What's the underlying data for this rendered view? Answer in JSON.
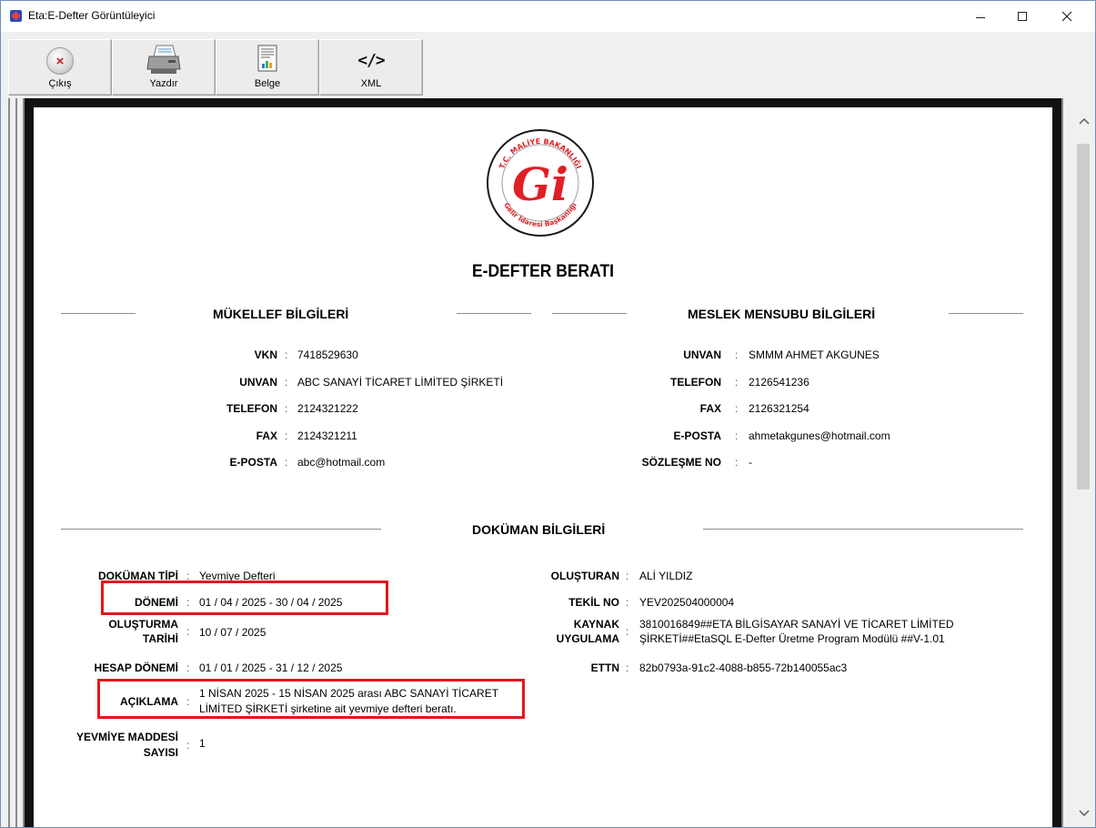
{
  "window": {
    "title": "Eta:E-Defter Görüntüleyici"
  },
  "toolbar": {
    "exit_label": "Çıkış",
    "print_label": "Yazdır",
    "document_label": "Belge",
    "xml_label": "XML",
    "xml_glyph": "</>"
  },
  "document": {
    "title": "E-DEFTER BERATI",
    "taxpayer": {
      "heading": "MÜKELLEF BİLGİLERİ",
      "fields": [
        {
          "label": "VKN",
          "value": "7418529630"
        },
        {
          "label": "UNVAN",
          "value": "ABC SANAYİ TİCARET LİMİTED ŞİRKETİ"
        },
        {
          "label": "TELEFON",
          "value": "2124321222"
        },
        {
          "label": "FAX",
          "value": "2124321211"
        },
        {
          "label": "E-POSTA",
          "value": "abc@hotmail.com"
        }
      ]
    },
    "accountant": {
      "heading": "MESLEK MENSUBU BİLGİLERİ",
      "fields": [
        {
          "label": "UNVAN",
          "value": "SMMM AHMET AKGUNES"
        },
        {
          "label": "TELEFON",
          "value": "2126541236"
        },
        {
          "label": "FAX",
          "value": "2126321254"
        },
        {
          "label": "E-POSTA",
          "value": "ahmetakgunes@hotmail.com"
        },
        {
          "label": "SÖZLEŞME NO",
          "value": "-"
        }
      ]
    },
    "doc_info": {
      "heading": "DOKÜMAN BİLGİLERİ",
      "left": [
        {
          "label": "DOKÜMAN TİPİ",
          "value": "Yevmiye Defteri"
        },
        {
          "label": "DÖNEMİ",
          "value": "01 / 04 / 2025 - 30 / 04 / 2025"
        },
        {
          "label1": "OLUŞTURMA",
          "label2": "TARİHİ",
          "value": "10 / 07 / 2025"
        },
        {
          "label": "HESAP DÖNEMİ",
          "value": "01 / 01 / 2025 - 31 / 12 / 2025"
        },
        {
          "label": "AÇIKLAMA",
          "value1": "1 NİSAN 2025 - 15 NİSAN 2025 arası ABC SANAYİ TİCARET",
          "value2": "LİMİTED ŞİRKETİ şirketine ait yevmiye defteri beratı."
        },
        {
          "label1": "YEVMİYE MADDESİ",
          "label2": "SAYISI",
          "value": "1"
        }
      ],
      "right": [
        {
          "label": "OLUŞTURAN",
          "value": "ALİ YILDIZ"
        },
        {
          "label": "TEKİL NO",
          "value": "YEV202504000004"
        },
        {
          "label1": "KAYNAK",
          "label2": "UYGULAMA",
          "value1": "3810016849##ETA BİLGİSAYAR SANAYİ VE TİCARET LİMİTED",
          "value2": "ŞİRKETİ##EtaSQL E-Defter Üretme Program Modülü ##V-1.01"
        },
        {
          "label": "ETTN",
          "value": "82b0793a-91c2-4088-b855-72b140055ac3"
        }
      ]
    },
    "colon": ":",
    "logo": {
      "top_text": "T.C. MALİYE BAKANLIĞI",
      "bottom_text": "Gelir İdaresi Başkanlığı",
      "glyph": "Gi"
    }
  },
  "colors": {
    "highlight": "#e8141c",
    "logo_red": "#e01f26"
  }
}
